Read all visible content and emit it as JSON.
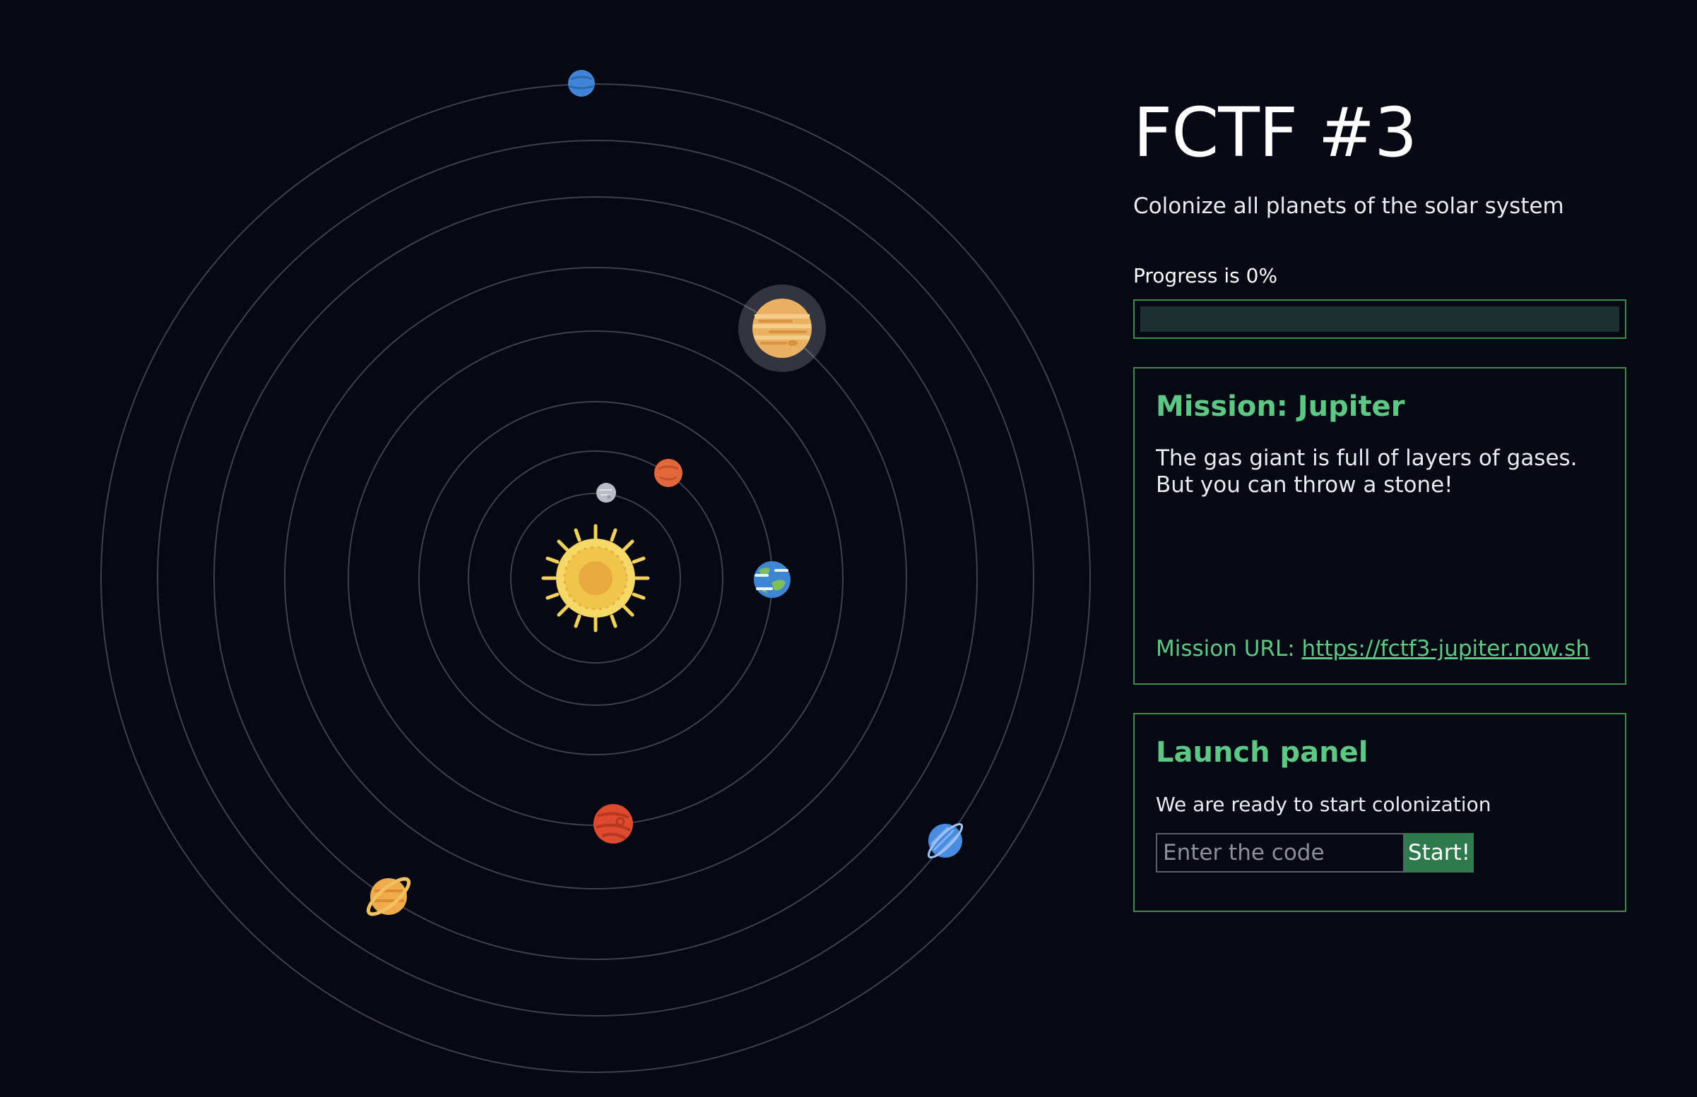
{
  "header": {
    "title": "FCTF #3",
    "subtitle": "Colonize all planets of the solar system"
  },
  "progress": {
    "label": "Progress is 0%",
    "value": 0
  },
  "mission": {
    "label": "Mission:",
    "planet": "Jupiter",
    "description": "The gas giant is full of layers of gases. But you can throw a stone!",
    "url_label": "Mission URL:",
    "url": "https://fctf3-jupiter.now.sh"
  },
  "launch": {
    "heading": "Launch panel",
    "text": "We are ready to start colonization",
    "input_placeholder": "Enter the code",
    "input_value": "",
    "button_label": "Start!"
  },
  "solar_system": {
    "sun": {
      "icon": "sun-icon"
    },
    "planets": [
      {
        "name": "mercury",
        "icon": "mercury-icon",
        "color": "#b9bec6"
      },
      {
        "name": "venus",
        "icon": "venus-icon",
        "color": "#e2673a"
      },
      {
        "name": "earth",
        "icon": "earth-icon",
        "color": "#3e86d4"
      },
      {
        "name": "mars",
        "icon": "mars-icon",
        "color": "#dd4a2f"
      },
      {
        "name": "jupiter",
        "icon": "jupiter-icon",
        "color": "#eab063",
        "selected": true
      },
      {
        "name": "saturn",
        "icon": "saturn-icon",
        "color": "#efab4b"
      },
      {
        "name": "uranus",
        "icon": "uranus-icon",
        "color": "#4a8be0"
      },
      {
        "name": "neptune",
        "icon": "neptune-icon",
        "color": "#3f84d6"
      }
    ]
  },
  "colors": {
    "background": "#060914",
    "accent": "#5dc884",
    "border": "#3c8a4c",
    "button": "#2f7a4c",
    "orbit": "#3b4150"
  }
}
